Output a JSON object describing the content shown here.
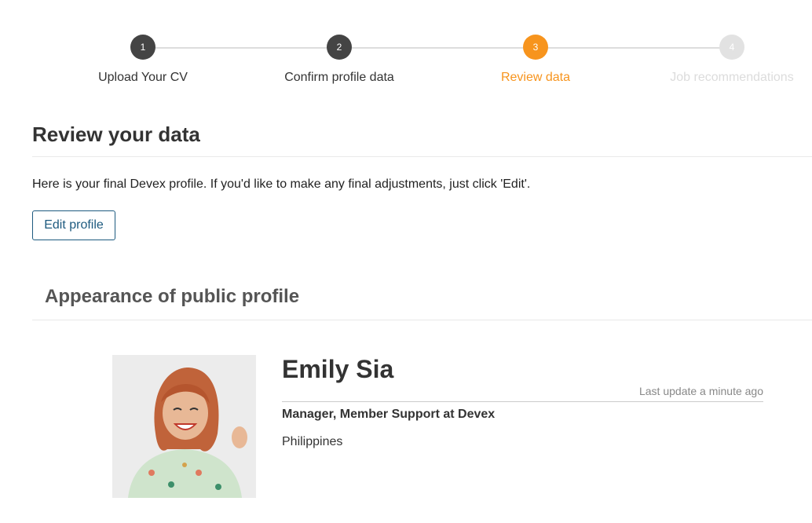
{
  "stepper": {
    "steps": [
      {
        "number": "1",
        "label": "Upload Your CV",
        "state": "done"
      },
      {
        "number": "2",
        "label": "Confirm profile data",
        "state": "done"
      },
      {
        "number": "3",
        "label": "Review data",
        "state": "active"
      },
      {
        "number": "4",
        "label": "Job recommendations",
        "state": "pending"
      }
    ]
  },
  "review": {
    "title": "Review your data",
    "intro": "Here is your final Devex profile. If you'd like to make any final adjustments, just click 'Edit'.",
    "edit_label": "Edit profile"
  },
  "public_profile": {
    "title": "Appearance of public profile",
    "name": "Emily Sia",
    "last_update": "Last update a minute ago",
    "position": "Manager, Member Support at Devex",
    "location": "Philippines"
  },
  "colors": {
    "accent": "#f7941d",
    "done": "#444444",
    "pending": "#e2e2e2",
    "button": "#1d5a7f"
  }
}
